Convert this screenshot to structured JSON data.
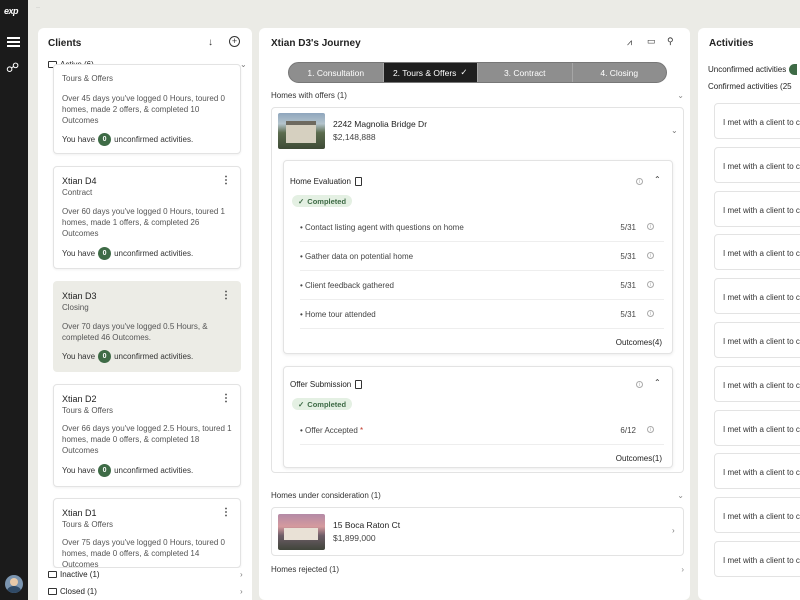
{
  "app": {
    "logo": "exp",
    "top_hint": "··"
  },
  "clients_panel": {
    "title": "Clients",
    "active_group": "Active (6)",
    "inactive_group": "Inactive (1)",
    "closed_group": "Closed (1)",
    "cards": [
      {
        "name": "",
        "stage": "Tours & Offers",
        "description": "Over 45 days you've logged 0 Hours, toured 0 homes, made 2 offers, & completed 10 Outcomes",
        "prefix": "You have",
        "count": "0",
        "suffix": "unconfirmed activities."
      },
      {
        "name": "Xtian D4",
        "stage": "Contract",
        "description": "Over 60 days you've logged 0 Hours, toured 1 homes, made 1 offers, & completed 26 Outcomes",
        "prefix": "You have",
        "count": "0",
        "suffix": "unconfirmed activities."
      },
      {
        "name": "Xtian D3",
        "stage": "Closing",
        "description": "Over 70 days you've logged 0.5 Hours, & completed 46 Outcomes.",
        "prefix": "You have",
        "count": "0",
        "suffix": "unconfirmed activities."
      },
      {
        "name": "Xtian D2",
        "stage": "Tours & Offers",
        "description": "Over 66 days you've logged 2.5 Hours, toured 1 homes, made 0 offers, & completed 18 Outcomes",
        "prefix": "You have",
        "count": "0",
        "suffix": "unconfirmed activities."
      },
      {
        "name": "Xtian D1",
        "stage": "Tours & Offers",
        "description": "Over 75 days you've logged 0 Hours, toured 0 homes, made 0 offers, & completed 14 Outcomes",
        "prefix": "",
        "count": "",
        "suffix": ""
      }
    ]
  },
  "journey": {
    "title": "Xtian D3's Journey",
    "steps": [
      "1. Consultation",
      "2. Tours & Offers",
      "3. Contract",
      "4. Closing"
    ],
    "active_step": 1,
    "homes_with_offers": "Homes with offers (1)",
    "home1": {
      "address": "2242 Magnolia Bridge Dr",
      "price": "$2,148,888"
    },
    "home_evaluation": {
      "title": "Home Evaluation",
      "status": "Completed",
      "tasks": [
        {
          "label": "• Contact listing agent with questions on home",
          "date": "5/31"
        },
        {
          "label": "• Gather data on potential home",
          "date": "5/31"
        },
        {
          "label": "• Client feedback gathered",
          "date": "5/31"
        },
        {
          "label": "• Home tour attended",
          "date": "5/31"
        }
      ],
      "outcomes": "Outcomes(4)"
    },
    "offer_submission": {
      "title": "Offer Submission",
      "status": "Completed",
      "task_label": "• Offer Accepted",
      "task_required": "*",
      "task_date": "6/12",
      "outcomes": "Outcomes(1)"
    },
    "homes_under_consideration": "Homes under consideration (1)",
    "home2": {
      "address": "15 Boca Raton Ct",
      "price": "$1,899,000"
    },
    "homes_rejected": "Homes rejected (1)"
  },
  "activities": {
    "title": "Activities",
    "unconfirmed": "Unconfirmed activities",
    "confirmed": "Confirmed activities (25",
    "item_text": "I met with a client to c",
    "count_items": 11
  },
  "colors": {
    "accent_green": "#3e6b46",
    "rail": "#1b1b1b",
    "active_step": "#1f1f1f"
  }
}
